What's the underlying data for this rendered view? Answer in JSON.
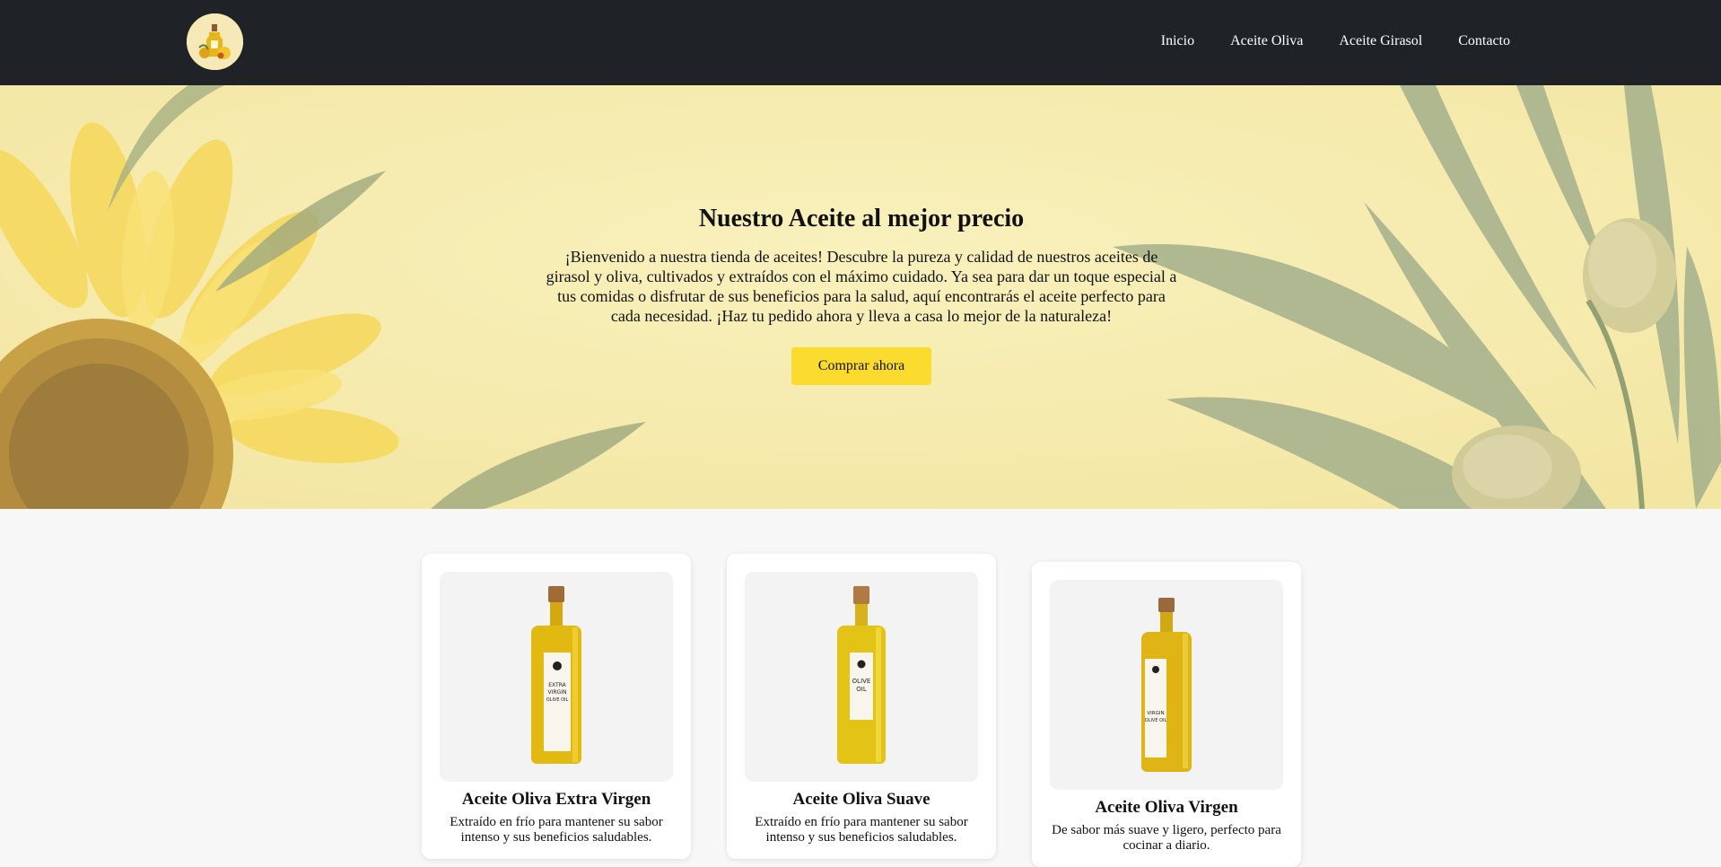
{
  "nav": {
    "logo": "logo-oil-icon",
    "links": [
      "Inicio",
      "Aceite Oliva",
      "Aceite Girasol",
      "Contacto"
    ]
  },
  "hero": {
    "title": "Nuestro Aceite al mejor precio",
    "text": "¡Bienvenido a nuestra tienda de aceites! Descubre la pureza y calidad de nuestros aceites de girasol y oliva, cultivados y extraídos con el máximo cuidado. Ya sea para dar un toque especial a tus comidas o disfrutar de sus beneficios para la salud, aquí encontrarás el aceite perfecto para cada necesidad. ¡Haz tu pedido ahora y lleva a casa lo mejor de la naturaleza!",
    "button": "Comprar ahora"
  },
  "products": [
    {
      "title": "Aceite Oliva Extra Virgen",
      "desc": "Extraído en frío para mantener su sabor intenso y sus beneficios saludables.",
      "label": [
        "EXTRA",
        "VIRGIN",
        "OLIVE OIL"
      ]
    },
    {
      "title": "Aceite Oliva Suave",
      "desc": "Extraído en frío para mantener su sabor intenso y sus beneficios saludables.",
      "label": [
        "OLIVE",
        "OIL"
      ]
    },
    {
      "title": "Aceite Oliva Virgen",
      "desc": "De sabor más suave y ligero, perfecto para cocinar a diario.",
      "label": [
        "VIRGIN",
        "OLIVE OIL"
      ]
    }
  ],
  "colors": {
    "navbar": "#1f2328",
    "accent": "#fbdb2e",
    "hero_bg": "#f5ebad"
  }
}
